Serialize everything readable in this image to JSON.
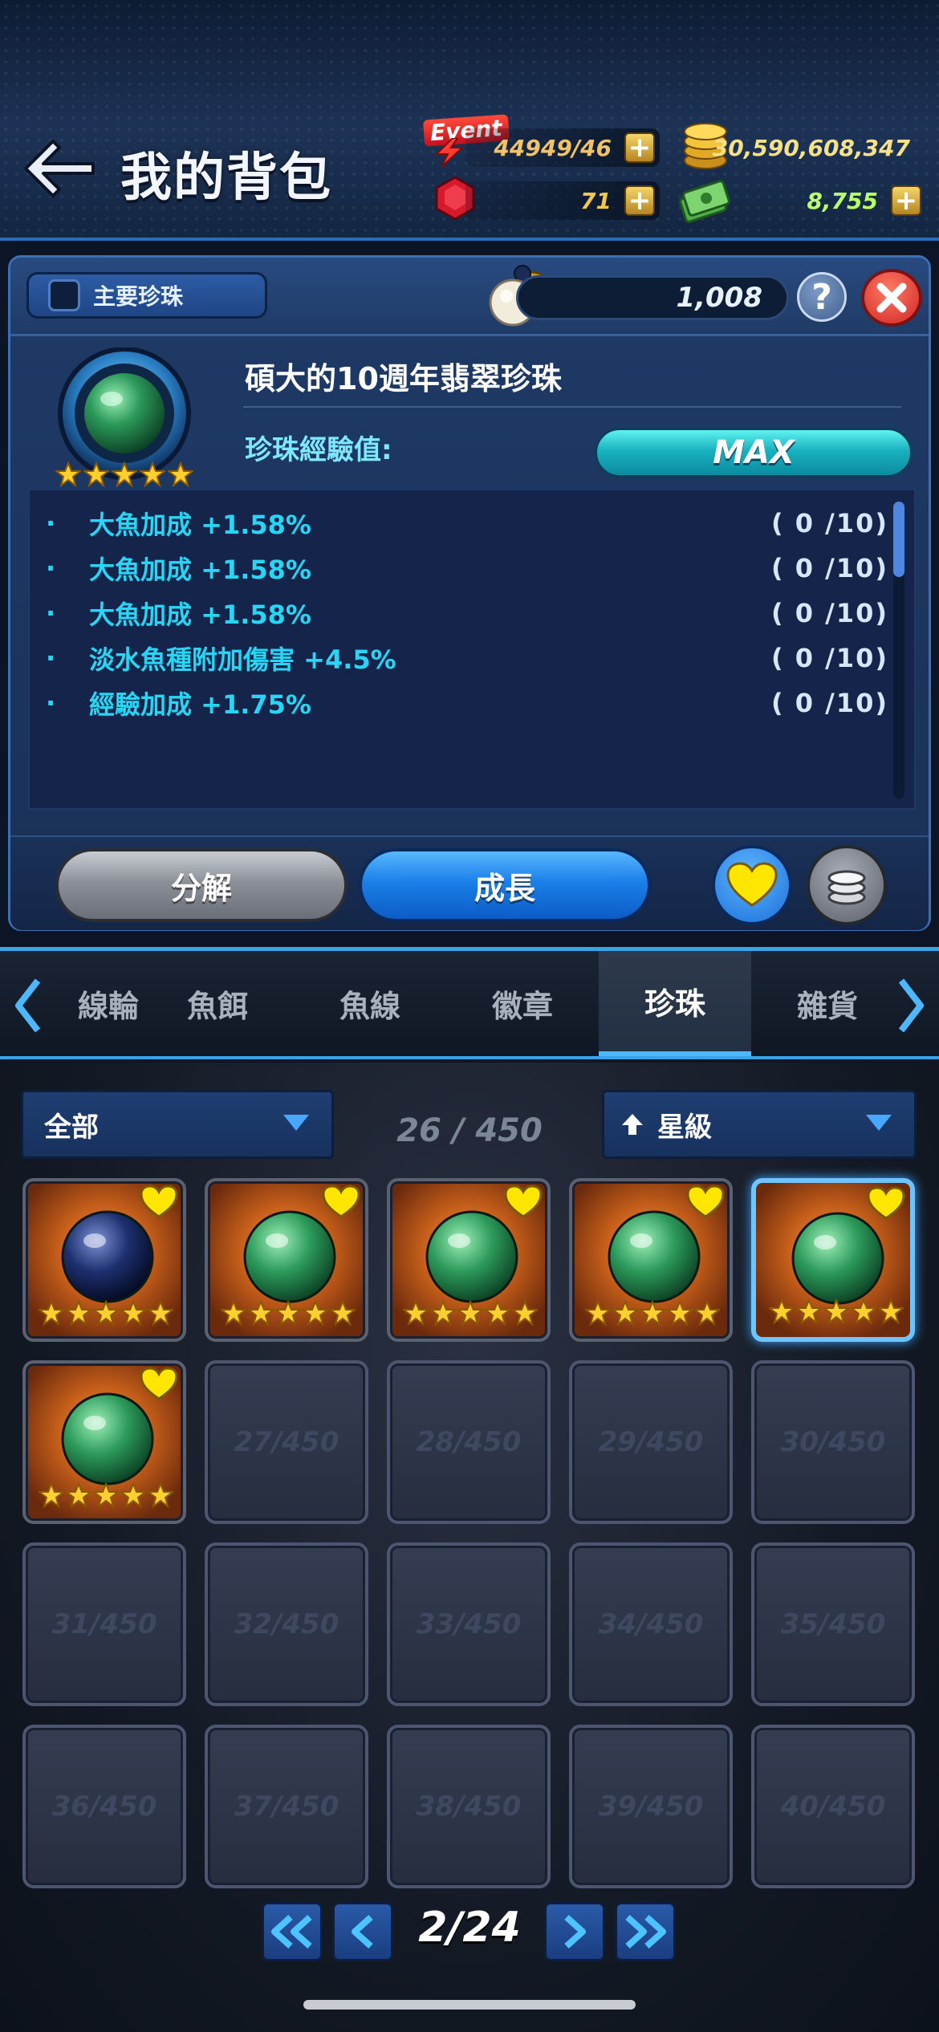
{
  "header": {
    "title": "我的背包",
    "event_label": "Event",
    "event_value": "44949/46",
    "coins": "30,590,608,347",
    "gems": "71",
    "cash": "8,755"
  },
  "panel": {
    "main_pearl_label": "主要珍珠",
    "pearl_count": "1,008",
    "pearl_name": "碩大的10週年翡翠珍珠",
    "exp_label": "珍珠經驗值:",
    "exp_value": "MAX",
    "exp_progress": 1.0,
    "stars": 5,
    "attributes": [
      {
        "bullet": "·",
        "text": "大魚加成 +1.58%",
        "count": "( 0 /10)"
      },
      {
        "bullet": "·",
        "text": "大魚加成 +1.58%",
        "count": "( 0 /10)"
      },
      {
        "bullet": "·",
        "text": "大魚加成 +1.58%",
        "count": "( 0 /10)"
      },
      {
        "bullet": "·",
        "text": "淡水魚種附加傷害 +4.5%",
        "count": "( 0 /10)"
      },
      {
        "bullet": "·",
        "text": "經驗加成 +1.75%",
        "count": "( 0 /10)"
      }
    ],
    "decompose_label": "分解",
    "grow_label": "成長"
  },
  "tabs": [
    "線輪",
    "魚餌",
    "魚線",
    "徽章",
    "珍珠",
    "雜貨"
  ],
  "active_tab": "珍珠",
  "inventory": {
    "filter_label": "全部",
    "sort_label": "星級",
    "slot_counter": "26 / 450",
    "empty_slots": [
      "27/450",
      "28/450",
      "29/450",
      "30/450",
      "31/450",
      "32/450",
      "33/450",
      "34/450",
      "35/450",
      "36/450",
      "37/450",
      "38/450",
      "39/450",
      "40/450"
    ],
    "filled_items": [
      {
        "orb": "dark-blue",
        "stars": 5,
        "favorite": true
      },
      {
        "orb": "jade-green",
        "stars": 5,
        "favorite": true
      },
      {
        "orb": "jade-green",
        "stars": 5,
        "favorite": true
      },
      {
        "orb": "jade-green",
        "stars": 5,
        "favorite": true
      },
      {
        "orb": "jade-green",
        "stars": 5,
        "favorite": true,
        "selected": true
      },
      {
        "orb": "jade-green",
        "stars": 5,
        "favorite": true
      }
    ]
  },
  "pager": {
    "page_text": "2/24"
  },
  "colors": {
    "accent_blue": "#3aa4e8",
    "attr_text": "#27d6f5",
    "exp_bar": "#19b2bf",
    "gold": "#f4d56a",
    "heart": "#ffe600"
  },
  "icons": {
    "back": "back-arrow-icon",
    "coin": "gold-coin-stack-icon",
    "gem": "red-gem-icon",
    "cash": "cash-bundle-icon",
    "pearl": "pearl-icon",
    "help": "question-icon",
    "close": "close-x-icon",
    "favorite": "heart-icon",
    "stack": "coin-stack-icon"
  }
}
